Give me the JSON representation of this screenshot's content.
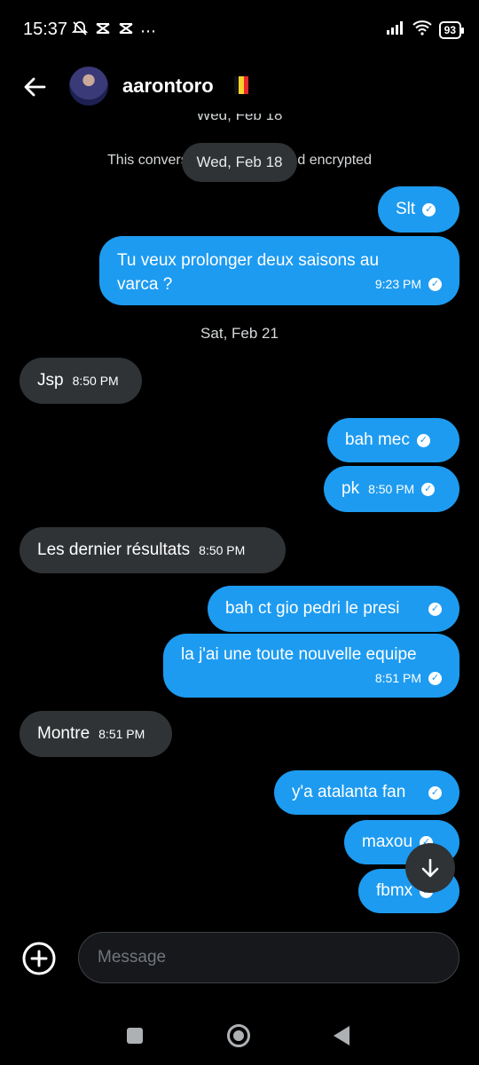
{
  "status_bar": {
    "time": "15:37",
    "left_icons": [
      "notifications-off-icon",
      "capcut-icon",
      "capcut-icon",
      "more-icon"
    ],
    "battery": "93"
  },
  "header": {
    "username": "aarontoro",
    "flag": "belgium-flag"
  },
  "chat": {
    "top_date_partial": "Wed, Feb 18",
    "encryption_notice": "This conversation is end-to-end encrypted",
    "date_pill": "Wed, Feb 18",
    "date_sat": "Sat, Feb 21",
    "messages": [
      {
        "dir": "out",
        "text": "Slt",
        "time": ""
      },
      {
        "dir": "out",
        "text": "Tu veux prolonger deux saisons au",
        "text2": "varca ?",
        "time": "9:23 PM"
      },
      {
        "dir": "in",
        "text": "Jsp",
        "time": "8:50 PM"
      },
      {
        "dir": "out",
        "text": "bah mec",
        "time": ""
      },
      {
        "dir": "out",
        "text": "pk",
        "time": "8:50 PM"
      },
      {
        "dir": "in",
        "text": "Les dernier résultats",
        "time": "8:50 PM"
      },
      {
        "dir": "out",
        "text": "bah ct gio pedri le presi",
        "time": ""
      },
      {
        "dir": "out",
        "text": "la j'ai une toute nouvelle equipe",
        "time": "8:51 PM"
      },
      {
        "dir": "in",
        "text": "Montre",
        "time": "8:51 PM"
      },
      {
        "dir": "out",
        "text": "y'a atalanta fan",
        "time": ""
      },
      {
        "dir": "out",
        "text": "maxou",
        "time": ""
      },
      {
        "dir": "out",
        "text": "fbmx",
        "time": ""
      }
    ]
  },
  "composer": {
    "placeholder": "Message"
  },
  "colors": {
    "accent": "#1d9bf0",
    "incoming_bubble": "#2f3336",
    "background": "#000000"
  }
}
